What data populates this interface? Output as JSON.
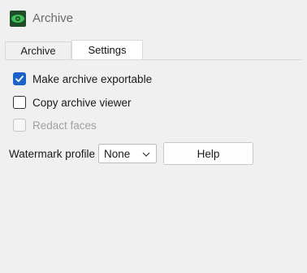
{
  "window": {
    "title": "Archive",
    "icon": "eye-icon"
  },
  "tabs": [
    {
      "label": "Archive",
      "active": false
    },
    {
      "label": "Settings",
      "active": true
    }
  ],
  "settings": {
    "checkboxes": [
      {
        "label": "Make archive exportable",
        "checked": true,
        "enabled": true
      },
      {
        "label": "Copy archive viewer",
        "checked": false,
        "enabled": true
      },
      {
        "label": "Redact faces",
        "checked": false,
        "enabled": false
      }
    ],
    "watermark": {
      "label": "Watermark profile",
      "selected": "None"
    },
    "help_label": "Help"
  },
  "colors": {
    "accent": "#1a63c9",
    "icon_bg": "#1f4d2a",
    "icon_fg": "#3fbf55"
  }
}
